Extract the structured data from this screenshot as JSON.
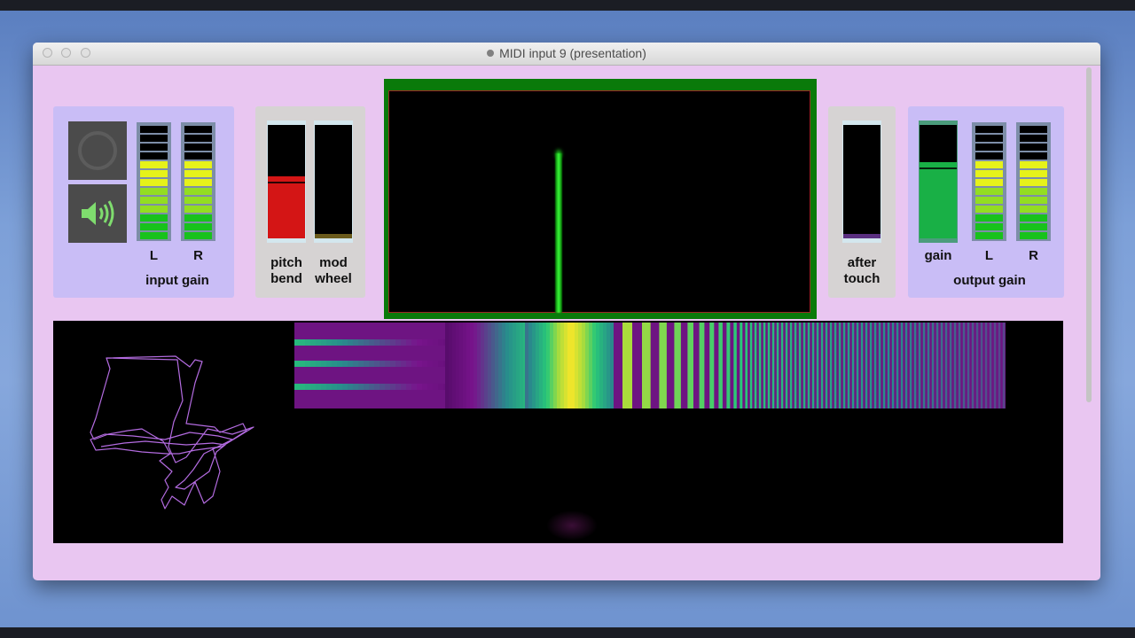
{
  "window": {
    "title": "MIDI input 9 (presentation)"
  },
  "input_section": {
    "label": "input gain",
    "left_label": "L",
    "right_label": "R",
    "left_level": 0.72,
    "right_level": 0.72,
    "power_icon": "power-ring-icon",
    "speaker_icon": "speaker-icon"
  },
  "pitch_bend": {
    "label_line1": "pitch",
    "label_line2": "bend",
    "value": 0.55,
    "color": "#d41515"
  },
  "mod_wheel": {
    "label_line1": "mod",
    "label_line2": "wheel",
    "value": 0.04,
    "color": "#6a5a1c"
  },
  "after_touch": {
    "label_line1": "after",
    "label_line2": "touch",
    "value": 0.04,
    "color": "#5a2f80"
  },
  "output_section": {
    "label": "output gain",
    "gain_label": "gain",
    "left_label": "L",
    "right_label": "R",
    "gain_value": 0.67,
    "gain_color": "#19b046",
    "left_level": 0.72,
    "right_level": 0.72
  },
  "colors": {
    "window_bg": "#e9c6f1",
    "panel_bg": "#c9bdf6",
    "control_panel_bg": "#d6d3d3",
    "scope_frame": "#0a7a0a",
    "trace_color": "#b36be0"
  }
}
